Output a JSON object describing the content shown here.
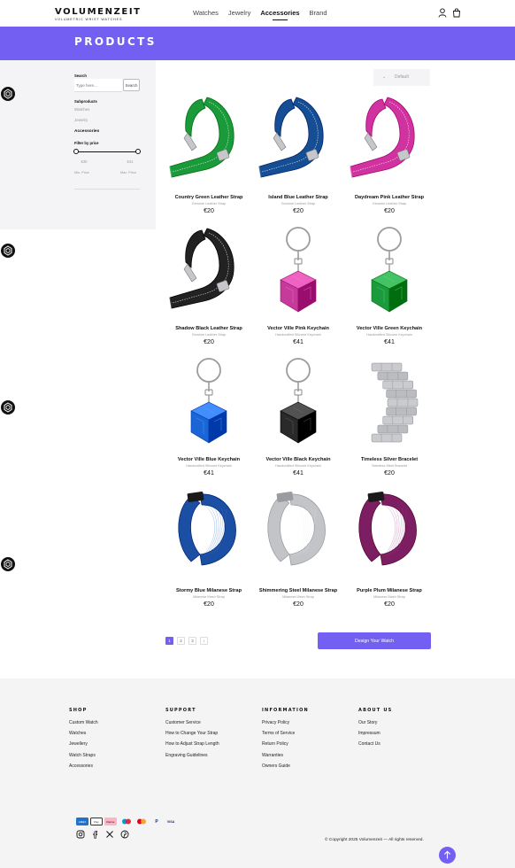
{
  "header": {
    "logo": "VOLUMENZEIT",
    "tagline": "VOLUMETRIC WRIST WATCHES",
    "nav": [
      "Watches",
      "Jewelry",
      "Accessories",
      "Brand"
    ],
    "active_nav": "Accessories"
  },
  "banner": {
    "title": "PRODUCTS"
  },
  "sidebar": {
    "search_label": "Search",
    "search_placeholder": "Type here...",
    "search_button": "Search",
    "subproducts_label": "Subproducts",
    "subproducts": [
      "Watches",
      "Jewelry"
    ],
    "accessories_label": "Accessories",
    "filter_label": "Filter by price",
    "min_value": "€20",
    "max_value": "€41",
    "min_label": "Min. Price",
    "max_label": "Max. Price"
  },
  "sort": {
    "selected": "Default",
    "arrow": "⌄"
  },
  "products": [
    {
      "name": "Country Green Leather Strap",
      "category": "Genuine Leather Strap",
      "price": "€20",
      "kind": "leather",
      "color": "#1a9a3a"
    },
    {
      "name": "Island Blue Leather Strap",
      "category": "Genuine Leather Strap",
      "price": "€20",
      "kind": "leather",
      "color": "#154e94"
    },
    {
      "name": "Daydream Pink Leather Strap",
      "category": "Genuine Leather Strap",
      "price": "€20",
      "kind": "leather",
      "color": "#d0339f"
    },
    {
      "name": "Shadow Black Leather Strap",
      "category": "Genuine Leather Strap",
      "price": "€20",
      "kind": "leather",
      "color": "#222222"
    },
    {
      "name": "Vector Ville Pink Keychain",
      "category": "Handcrafted Silicone Keychain",
      "price": "€41",
      "kind": "keychain",
      "color": "#c63a9a"
    },
    {
      "name": "Vector Ville Green Keychain",
      "category": "Handcrafted Silicone Keychain",
      "price": "€41",
      "kind": "keychain",
      "color": "#1c9b3c"
    },
    {
      "name": "Vector Ville Blue Keychain",
      "category": "Handcrafted Silicone Keychain",
      "price": "€41",
      "kind": "keychain",
      "color": "#1b66d6"
    },
    {
      "name": "Vector Ville Black Keychain",
      "category": "Handcrafted Silicone Keychain",
      "price": "€41",
      "kind": "keychain",
      "color": "#2a2a2a"
    },
    {
      "name": "Timeless Silver Bracelet",
      "category": "Stainless Steel Bracelet",
      "price": "€20",
      "kind": "bracelet",
      "color": "#c9cbcf"
    },
    {
      "name": "Stormy Blue Milanese Strap",
      "category": "Milanese Mesh Strap",
      "price": "€20",
      "kind": "milanese",
      "color": "#1a4fa3"
    },
    {
      "name": "Shimmering Steel Milanese Strap",
      "category": "Milanese Mesh Strap",
      "price": "€20",
      "kind": "milanese",
      "color": "#c2c4c8"
    },
    {
      "name": "Purple Plum Milanese Strap",
      "category": "Milanese Mesh Strap",
      "price": "€20",
      "kind": "milanese",
      "color": "#7d1e62"
    }
  ],
  "pagination": {
    "pages": [
      "1",
      "2",
      "3",
      "›"
    ],
    "active": "1"
  },
  "design_button": "Design Your Watch",
  "footer": {
    "shop": {
      "title": "SHOP",
      "links": [
        "Custom Watch",
        "Watches",
        "Jewellery",
        "Watch Straps",
        "Accessories"
      ]
    },
    "support": {
      "title": "SUPPORT",
      "links": [
        "Customer Service",
        "How to Change Your Strap",
        "How to Adjust Strap Length",
        "Engraving Guidelines"
      ]
    },
    "information": {
      "title": "INFORMATION",
      "links": [
        "Privacy Policy",
        "Terms of Service",
        "Return Policy",
        "Warranties",
        "Owners Guide"
      ]
    },
    "about": {
      "title": "ABOUT US",
      "links": [
        "Our Story",
        "Impressum",
        "Contact Us"
      ]
    },
    "payments": [
      "Amex",
      "Apple Pay",
      "Klarna",
      "Maestro",
      "Mastercard",
      "PayPal",
      "Visa"
    ],
    "payment_labels": [
      "AMEX",
      "Pay",
      "Klarna.",
      "",
      "",
      "P",
      "VISA"
    ],
    "social": [
      "instagram-icon",
      "facebook-icon",
      "x-icon",
      "pinterest-icon"
    ],
    "copyright": "© Copyright 2025 Volumenzeit — All rights reserved."
  },
  "colors": {
    "accent": "#7360f2",
    "sidebar": "#f4f4f6",
    "footer": "#f4f4f4"
  }
}
